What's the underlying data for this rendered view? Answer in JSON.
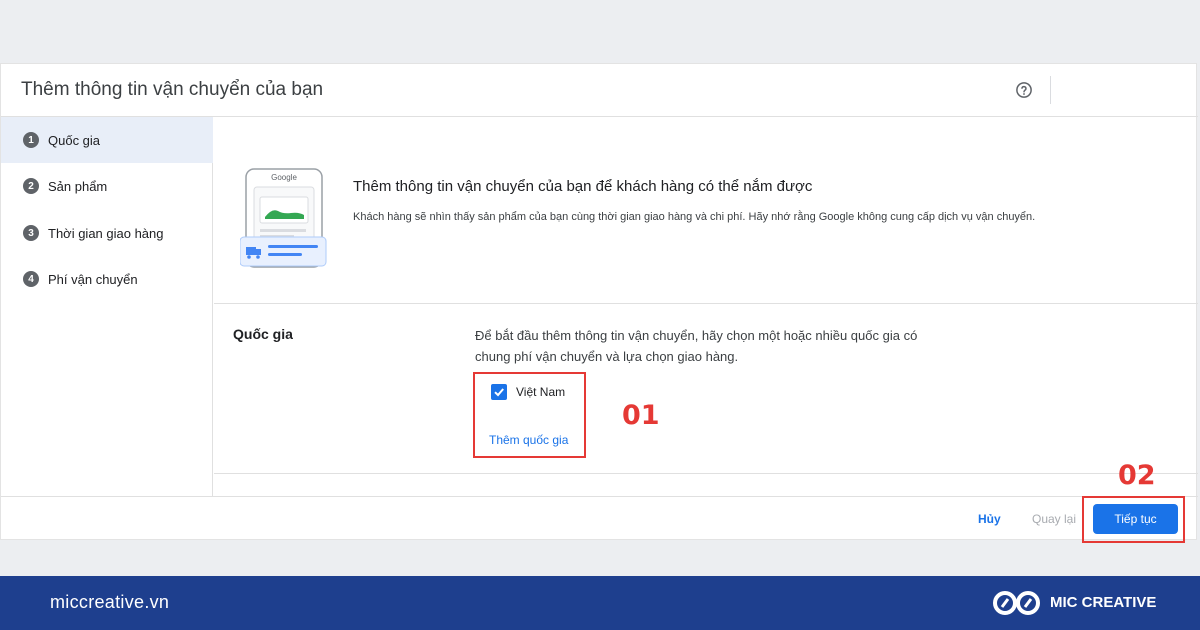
{
  "dialog": {
    "title": "Thêm thông tin vận chuyển của bạn",
    "help_icon": "help-circle-icon"
  },
  "sidebar": {
    "steps": [
      {
        "number": "1",
        "label": "Quốc gia",
        "active": true
      },
      {
        "number": "2",
        "label": "Sản phẩm",
        "active": false
      },
      {
        "number": "3",
        "label": "Thời gian giao hàng",
        "active": false
      },
      {
        "number": "4",
        "label": "Phí vận chuyển",
        "active": false
      }
    ]
  },
  "intro": {
    "illustration_brand": "Google",
    "title": "Thêm thông tin vận chuyển của bạn để khách hàng có thể nắm được",
    "description": "Khách hàng sẽ nhìn thấy sản phẩm của bạn cùng thời gian giao hàng và chi phí. Hãy nhớ rằng Google không cung cấp dịch vụ vận chuyển."
  },
  "country_section": {
    "label": "Quốc gia",
    "description": "Để bắt đầu thêm thông tin vận chuyển, hãy chọn một hoặc nhiều quốc gia có chung phí vận chuyển và lựa chọn giao hàng.",
    "countries": [
      {
        "name": "Việt Nam",
        "checked": true
      }
    ],
    "add_country_label": "Thêm quốc gia"
  },
  "annotations": {
    "step1": "01",
    "step2": "02"
  },
  "footer": {
    "cancel_label": "Hủy",
    "back_label": "Quay lại",
    "continue_label": "Tiếp tục"
  },
  "branding": {
    "site": "miccreative.vn",
    "name": "MIC CREATIVE",
    "logo_icon": "infinity-logo-icon"
  },
  "colors": {
    "primary": "#1a73e8",
    "annotation_red": "#e53935",
    "brand_bar": "#1e3f8e",
    "active_step_bg": "#e8eef8"
  }
}
